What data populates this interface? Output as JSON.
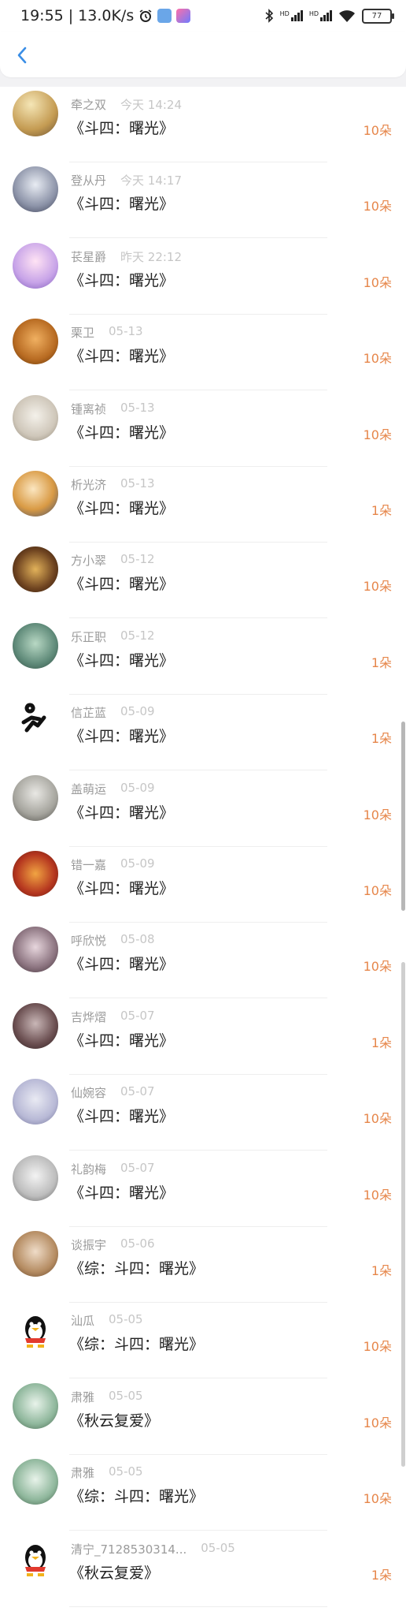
{
  "status_bar": {
    "time": "19:55",
    "speed": "13.0K/s",
    "network1": "HD",
    "network2": "HD",
    "battery": "77"
  },
  "colors": {
    "accent": "#3a8ee6",
    "count": "#e6864a"
  },
  "items": [
    {
      "name": "牵之双",
      "time": "今天 14:24",
      "title": "《斗四：曙光》",
      "count": "10朵"
    },
    {
      "name": "登从丹",
      "time": "今天 14:17",
      "title": "《斗四：曙光》",
      "count": "10朵"
    },
    {
      "name": "苌星爵",
      "time": "昨天 22:12",
      "title": "《斗四：曙光》",
      "count": "10朵"
    },
    {
      "name": "栗卫",
      "time": "05-13",
      "title": "《斗四：曙光》",
      "count": "10朵"
    },
    {
      "name": "锺离祯",
      "time": "05-13",
      "title": "《斗四：曙光》",
      "count": "10朵"
    },
    {
      "name": "析光济",
      "time": "05-13",
      "title": "《斗四：曙光》",
      "count": "1朵"
    },
    {
      "name": "方小翠",
      "time": "05-12",
      "title": "《斗四：曙光》",
      "count": "10朵"
    },
    {
      "name": "乐正职",
      "time": "05-12",
      "title": "《斗四：曙光》",
      "count": "1朵"
    },
    {
      "name": "信芷蓝",
      "time": "05-09",
      "title": "《斗四：曙光》",
      "count": "1朵"
    },
    {
      "name": "盖萌运",
      "time": "05-09",
      "title": "《斗四：曙光》",
      "count": "10朵"
    },
    {
      "name": "错一嘉",
      "time": "05-09",
      "title": "《斗四：曙光》",
      "count": "10朵"
    },
    {
      "name": "呼欣悦",
      "time": "05-08",
      "title": "《斗四：曙光》",
      "count": "10朵"
    },
    {
      "name": "吉烨熠",
      "time": "05-07",
      "title": "《斗四：曙光》",
      "count": "1朵"
    },
    {
      "name": "仙婉容",
      "time": "05-07",
      "title": "《斗四：曙光》",
      "count": "10朵"
    },
    {
      "name": "礼韵梅",
      "time": "05-07",
      "title": "《斗四：曙光》",
      "count": "10朵"
    },
    {
      "name": "谈振宇",
      "time": "05-06",
      "title": "《综：斗四：曙光》",
      "count": "1朵"
    },
    {
      "name": "汕瓜",
      "time": "05-05",
      "title": "《综：斗四：曙光》",
      "count": "10朵"
    },
    {
      "name": "肃雅",
      "time": "05-05",
      "title": "《秋云复爱》",
      "count": "10朵"
    },
    {
      "name": "肃雅",
      "time": "05-05",
      "title": "《综：斗四：曙光》",
      "count": "10朵"
    },
    {
      "name": "清宁_7128530314...",
      "time": "05-05",
      "title": "《秋云复爱》",
      "count": "1朵"
    }
  ]
}
